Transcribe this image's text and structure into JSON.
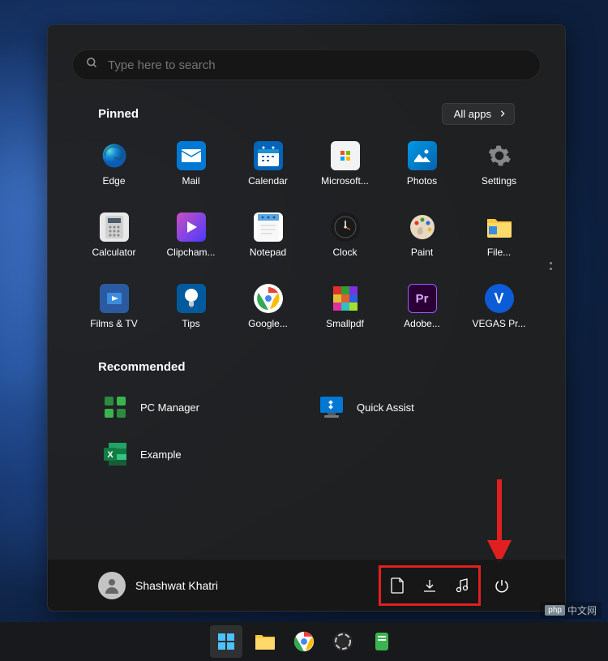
{
  "search": {
    "placeholder": "Type here to search"
  },
  "sections": {
    "pinned_title": "Pinned",
    "all_apps_label": "All apps",
    "recommended_title": "Recommended"
  },
  "pinned": [
    {
      "label": "Edge",
      "icon": "edge",
      "bg": "transparent"
    },
    {
      "label": "Mail",
      "icon": "mail",
      "bg": "#0078d4"
    },
    {
      "label": "Calendar",
      "icon": "calendar",
      "bg": "#0364b8"
    },
    {
      "label": "Microsoft...",
      "icon": "store",
      "bg": "#f3f3f3"
    },
    {
      "label": "Photos",
      "icon": "photos",
      "bg": "#0063b1"
    },
    {
      "label": "Settings",
      "icon": "settings",
      "bg": "transparent"
    },
    {
      "label": "Calculator",
      "icon": "calculator",
      "bg": "#e8e8e8"
    },
    {
      "label": "Clipcham...",
      "icon": "clipchamp",
      "bg": "transparent"
    },
    {
      "label": "Notepad",
      "icon": "notepad",
      "bg": "#57a6e4"
    },
    {
      "label": "Clock",
      "icon": "clock",
      "bg": "#1a1a1a"
    },
    {
      "label": "Paint",
      "icon": "paint",
      "bg": "transparent"
    },
    {
      "label": "File...",
      "icon": "folder",
      "bg": "transparent"
    },
    {
      "label": "Films & TV",
      "icon": "films",
      "bg": "#2c5aa0"
    },
    {
      "label": "Tips",
      "icon": "tips",
      "bg": "#005a9e"
    },
    {
      "label": "Google...",
      "icon": "chrome",
      "bg": "#fff"
    },
    {
      "label": "Smallpdf",
      "icon": "smallpdf",
      "bg": "transparent"
    },
    {
      "label": "Adobe...",
      "icon": "premiere",
      "bg": "#2a0034"
    },
    {
      "label": "VEGAS Pr...",
      "icon": "vegas",
      "bg": "#0b5cd6"
    }
  ],
  "recommended": [
    {
      "label": "PC Manager",
      "icon": "pcmanager"
    },
    {
      "label": "Quick Assist",
      "icon": "quickassist"
    },
    {
      "label": "Example",
      "icon": "excel"
    }
  ],
  "footer": {
    "username": "Shashwat Khatri",
    "shortcut_icons": [
      "documents",
      "downloads",
      "music"
    ],
    "power_icon": "power"
  },
  "taskbar": {
    "items": [
      "start",
      "explorer",
      "chrome",
      "obs",
      "app"
    ]
  },
  "watermark": {
    "text": "中文网",
    "prefix": "php"
  }
}
